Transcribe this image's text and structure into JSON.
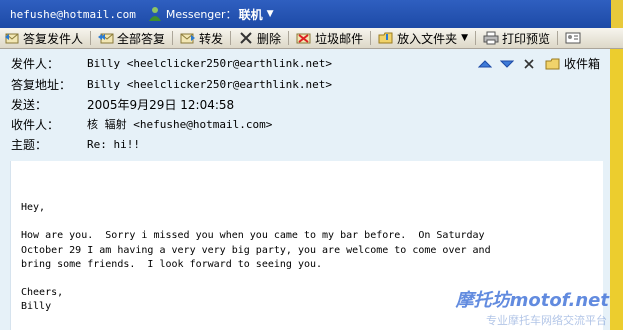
{
  "account": {
    "email": "hefushe@hotmail.com",
    "messenger_label": "Messenger：",
    "status": "联机"
  },
  "toolbar": {
    "reply": "答复发件人",
    "reply_all": "全部答复",
    "forward": "转发",
    "delete": "删除",
    "junk": "垃圾邮件",
    "move": "放入文件夹",
    "print": "打印预览"
  },
  "header": {
    "from_label": "发件人：",
    "from_value": "Billy <heelclicker250r@earthlink.net>",
    "reply_to_label": "答复地址：",
    "reply_to_value": "Billy <heelclicker250r@earthlink.net>",
    "sent_label": "发送：",
    "sent_value": "2005年9月29日 12:04:58",
    "to_label": "收件人：",
    "to_value": "核 辐射 <hefushe@hotmail.com>",
    "subject_label": "主题：",
    "subject_value": "Re: hi!!",
    "inbox_label": "收件箱"
  },
  "message": {
    "body": "Hey,\n\nHow are you.  Sorry i missed you when you came to my bar before.  On Saturday\nOctober 29 I am having a very very big party, you are welcome to come over and\nbring some friends.  I look forward to seeing you.\n\nCheers,\nBilly"
  },
  "watermark": {
    "text": "摩托坊motof.net",
    "subtext": "专业摩托车网络交流平台"
  }
}
